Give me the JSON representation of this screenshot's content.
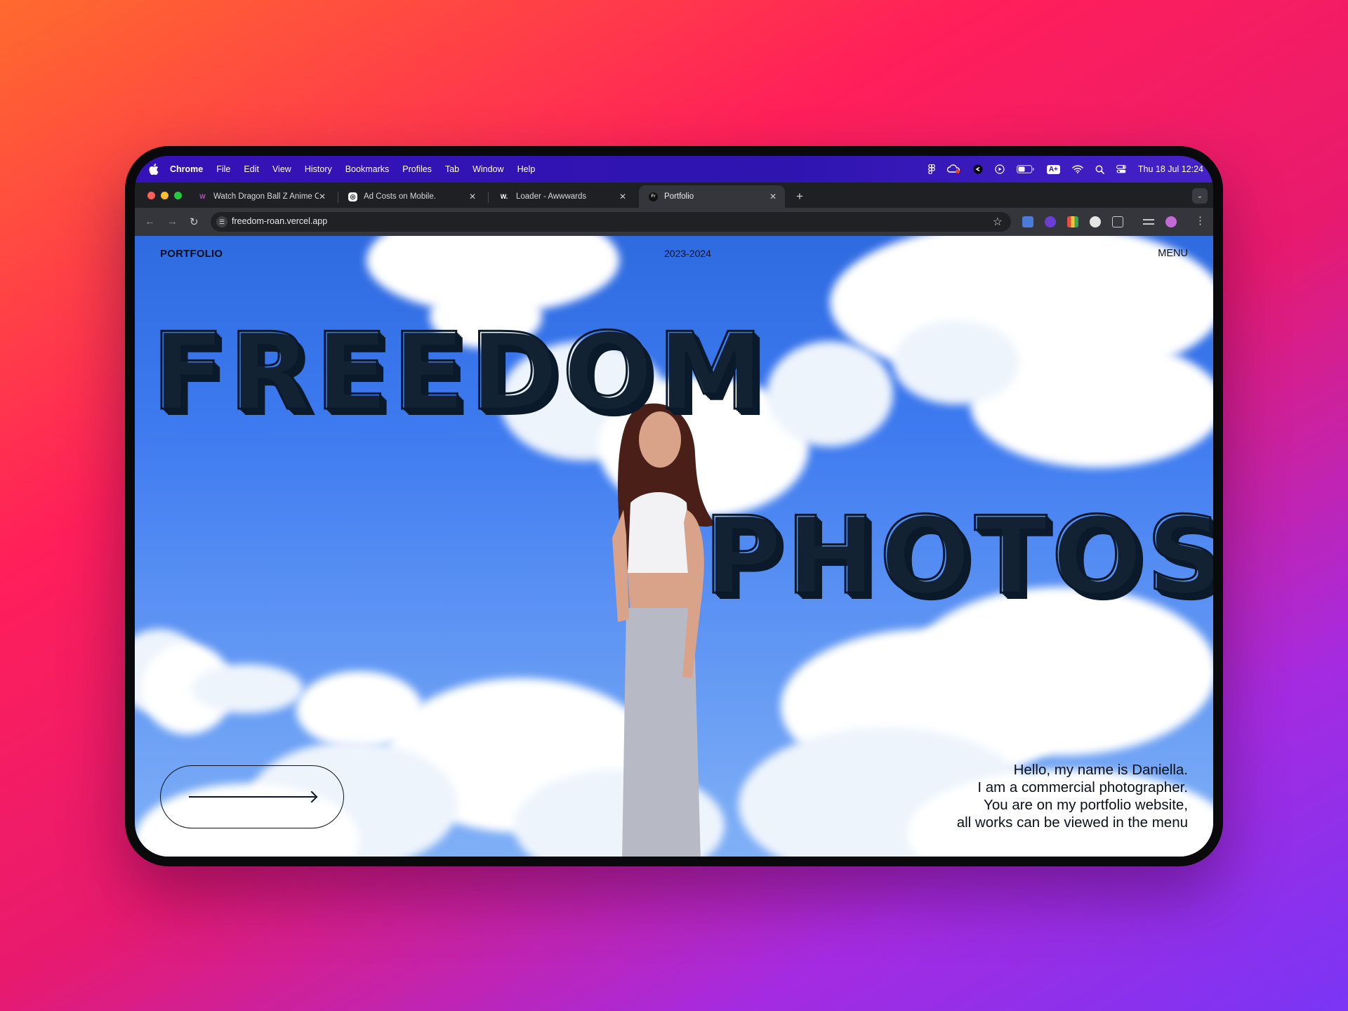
{
  "menubar": {
    "app_name": "Chrome",
    "items": [
      "File",
      "Edit",
      "View",
      "History",
      "Bookmarks",
      "Profiles",
      "Tab",
      "Window",
      "Help"
    ],
    "datetime": "Thu 18 Jul  12:24",
    "status_icons": [
      "figma-icon",
      "creative-cloud-icon",
      "app-icon",
      "play-icon",
      "battery-icon",
      "keyboard-input-icon",
      "wifi-icon",
      "spotlight-search-icon",
      "control-center-icon"
    ],
    "input_badge": "A+"
  },
  "tabs": [
    {
      "title": "Watch Dragon Ball Z Anime O",
      "favicon": "W"
    },
    {
      "title": "Ad Costs on Mobile.",
      "favicon": "◎"
    },
    {
      "title": "Loader - Awwwards",
      "favicon": "W."
    },
    {
      "title": "Portfolio",
      "favicon": "Fr",
      "active": true
    }
  ],
  "address_bar": {
    "url": "freedom-roan.vercel.app"
  },
  "page": {
    "nav_left": "PORTFOLIO",
    "nav_center": "2023-2024",
    "nav_right": "MENU",
    "headline_1": "FREEDOM",
    "headline_2": "PHOTOS",
    "intro_lines": [
      "Hello, my name is Daniella.",
      "I am a commercial photographer.",
      "You are on my portfolio website,",
      "all works can be viewed in the menu"
    ]
  },
  "colors": {
    "menubar": "#3512b8",
    "sky": "#3d7af0",
    "text": "#0b0f18"
  }
}
